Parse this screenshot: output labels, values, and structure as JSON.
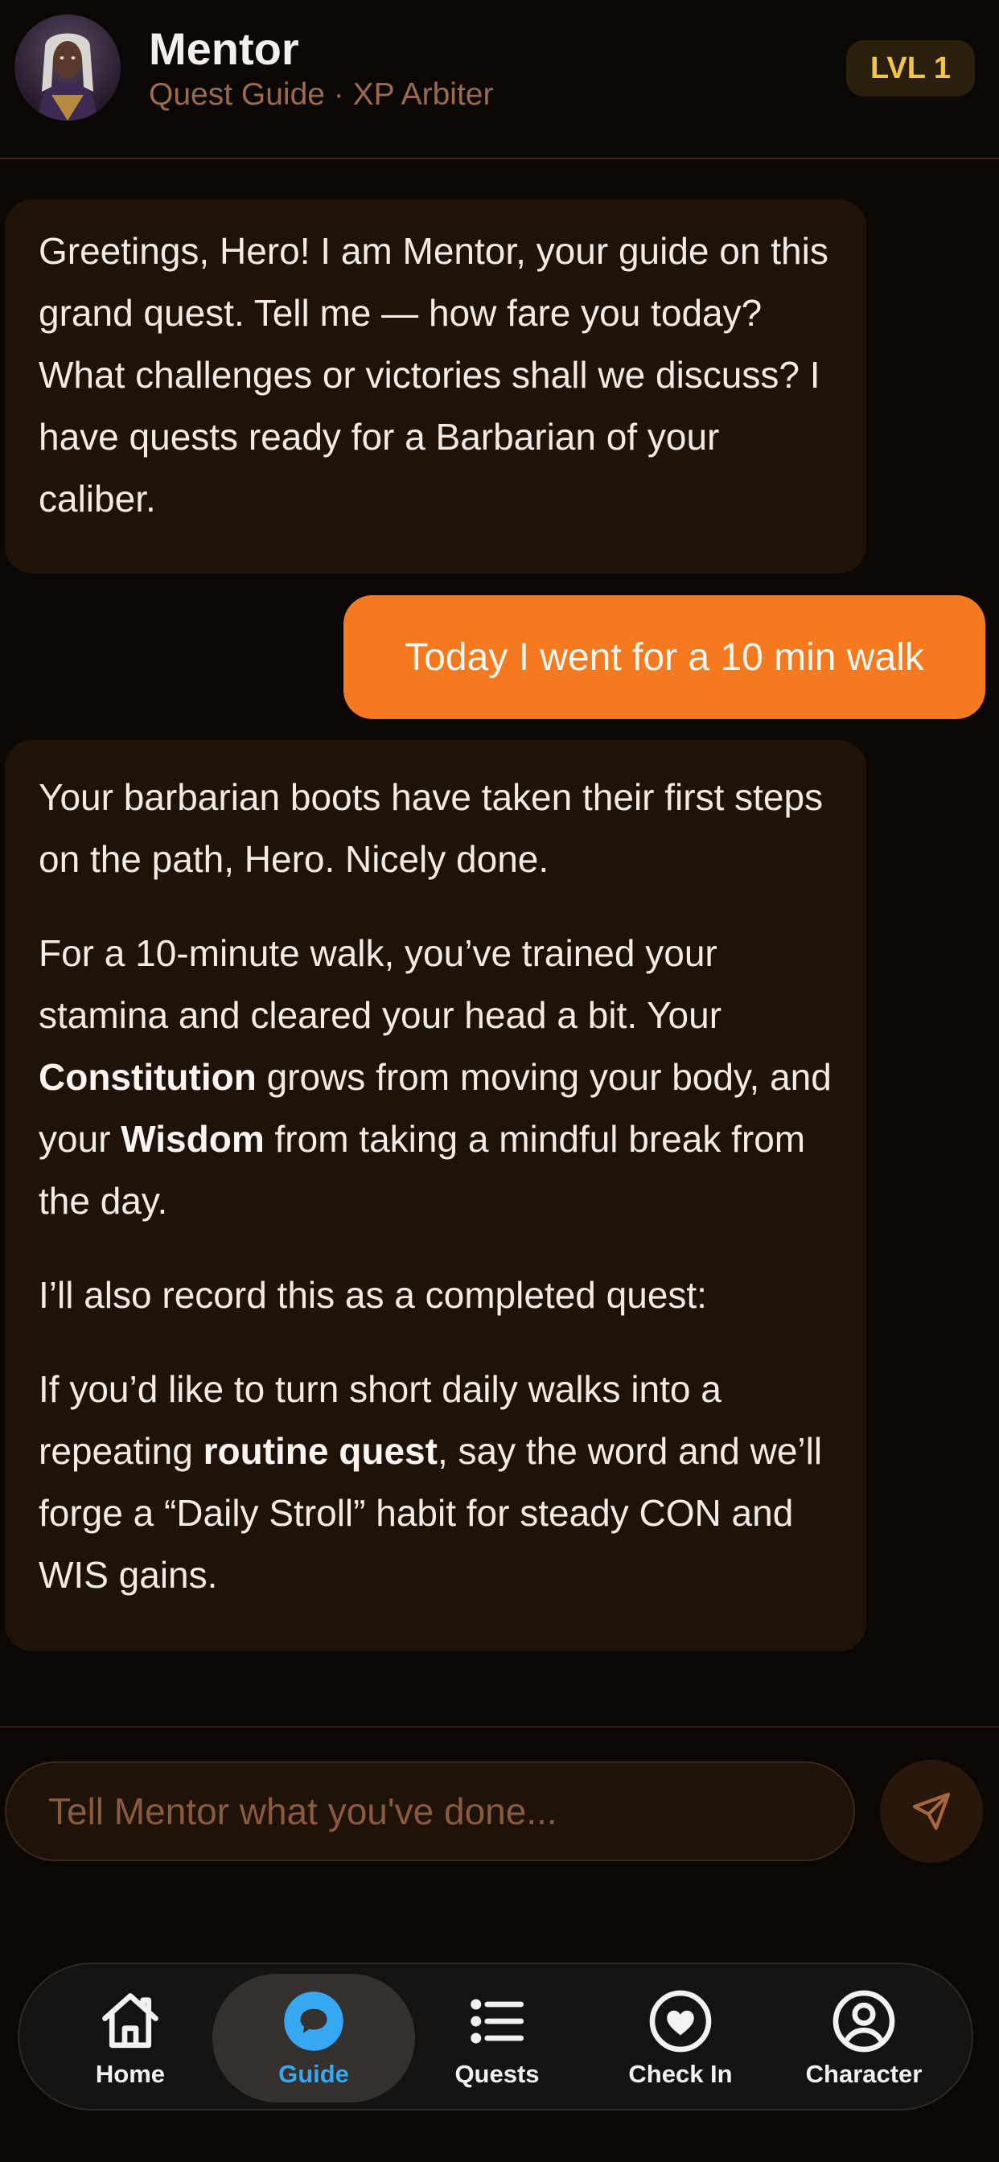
{
  "header": {
    "title": "Mentor",
    "subtitle": "Quest Guide · XP Arbiter",
    "level_badge": "LVL 1"
  },
  "messages": {
    "mentor_1": {
      "text": "Greetings, Hero! I am Mentor, your guide on this grand quest. Tell me — how fare you today? What challenges or victories shall we discuss? I have quests ready for a Barbarian of your caliber."
    },
    "user_1": {
      "text": "Today I went for a 10 min walk"
    },
    "mentor_2": {
      "p1": "Your barbarian boots have taken their first steps on the path, Hero. Nicely done.",
      "p2_a": "For a 10-minute walk, you’ve trained your stamina and cleared your head a bit. Your ",
      "p2_b1": "Constitution",
      "p2_c": " grows from moving your body, and your ",
      "p2_b2": "Wisdom",
      "p2_d": " from taking a mindful break from the day.",
      "p3": "I’ll also record this as a completed quest:",
      "p4_a": "If you’d like to turn short daily walks into a repeating ",
      "p4_b": "routine quest",
      "p4_c": ", say the word and we’ll forge a “Daily Stroll” habit for steady CON and WIS gains."
    }
  },
  "composer": {
    "placeholder": "Tell Mentor what you've done...",
    "send_icon": "paper-plane-icon"
  },
  "tabs": [
    {
      "label": "Home",
      "icon": "home-icon"
    },
    {
      "label": "Guide",
      "icon": "chat-bubble-icon",
      "active": true
    },
    {
      "label": "Quests",
      "icon": "list-icon"
    },
    {
      "label": "Check In",
      "icon": "heart-icon"
    },
    {
      "label": "Character",
      "icon": "user-circle-icon"
    }
  ],
  "colors": {
    "background": "#0b0705",
    "mentor_bubble": "#1f1208",
    "user_bubble": "#f57a1f",
    "accent_active_tab": "#36a7f2",
    "level_text": "#f4c545"
  }
}
